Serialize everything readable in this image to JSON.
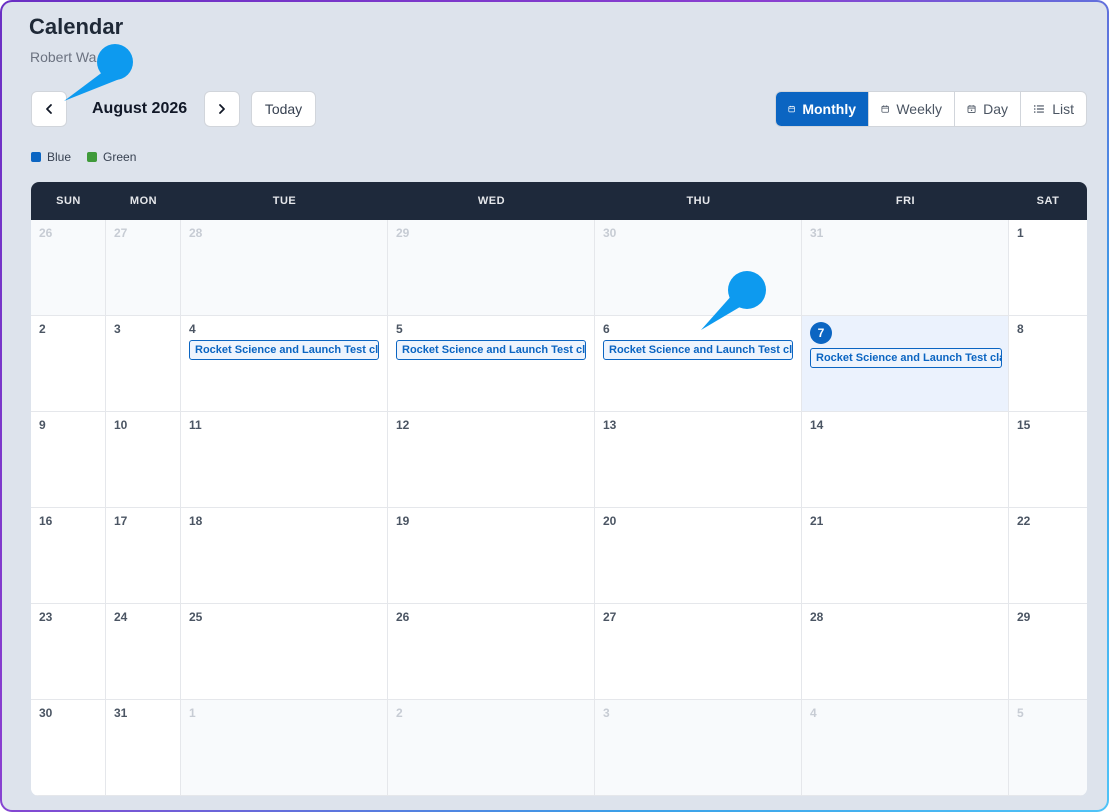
{
  "page": {
    "title": "Calendar",
    "subtitle": "Robert Wa"
  },
  "toolbar": {
    "month_label": "August 2026",
    "today_label": "Today",
    "views": [
      {
        "label": "Monthly",
        "icon": "calendar-icon",
        "active": true
      },
      {
        "label": "Weekly",
        "icon": "calendar-icon",
        "active": false
      },
      {
        "label": "Day",
        "icon": "calendar-day-icon",
        "active": false
      },
      {
        "label": "List",
        "icon": "list-icon",
        "active": false
      }
    ]
  },
  "legend": [
    {
      "label": "Blue",
      "color": "#0b65c2"
    },
    {
      "label": "Green",
      "color": "#3f9a3a"
    }
  ],
  "calendar": {
    "days_of_week": [
      "SUN",
      "MON",
      "TUE",
      "WED",
      "THU",
      "FRI",
      "SAT"
    ],
    "weeks": [
      [
        {
          "d": "26",
          "other": true
        },
        {
          "d": "27",
          "other": true
        },
        {
          "d": "28",
          "other": true
        },
        {
          "d": "29",
          "other": true
        },
        {
          "d": "30",
          "other": true
        },
        {
          "d": "31",
          "other": true
        },
        {
          "d": "1"
        }
      ],
      [
        {
          "d": "2"
        },
        {
          "d": "3"
        },
        {
          "d": "4",
          "events": [
            "Rocket Science and Launch Test class"
          ]
        },
        {
          "d": "5",
          "events": [
            "Rocket Science and Launch Test class"
          ]
        },
        {
          "d": "6",
          "events": [
            "Rocket Science and Launch Test class"
          ]
        },
        {
          "d": "7",
          "today": true,
          "events": [
            "Rocket Science and Launch Test class"
          ]
        },
        {
          "d": "8"
        }
      ],
      [
        {
          "d": "9"
        },
        {
          "d": "10"
        },
        {
          "d": "11"
        },
        {
          "d": "12"
        },
        {
          "d": "13"
        },
        {
          "d": "14"
        },
        {
          "d": "15"
        }
      ],
      [
        {
          "d": "16"
        },
        {
          "d": "17"
        },
        {
          "d": "18"
        },
        {
          "d": "19"
        },
        {
          "d": "20"
        },
        {
          "d": "21"
        },
        {
          "d": "22"
        }
      ],
      [
        {
          "d": "23"
        },
        {
          "d": "24"
        },
        {
          "d": "25"
        },
        {
          "d": "26"
        },
        {
          "d": "27"
        },
        {
          "d": "28"
        },
        {
          "d": "29"
        }
      ],
      [
        {
          "d": "30"
        },
        {
          "d": "31"
        },
        {
          "d": "1",
          "other": true
        },
        {
          "d": "2",
          "other": true
        },
        {
          "d": "3",
          "other": true
        },
        {
          "d": "4",
          "other": true
        },
        {
          "d": "5",
          "other": true
        }
      ]
    ]
  }
}
